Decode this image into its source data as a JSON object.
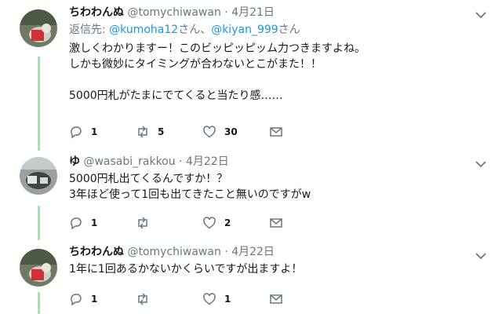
{
  "tweets": [
    {
      "name": "ちわわんぬ",
      "handle": "@tomychiwawan",
      "sep": "·",
      "date": "4月21日",
      "reply": {
        "prefix": "返信先: ",
        "user1": "@kumoha12",
        "joiner": "さん、",
        "user2": "@kiyan_999",
        "suffix": "さん"
      },
      "lines": [
        "激しくわかりますー！このビッピッピッム力つきますよね。",
        "しかも微妙にタイミングが合わないとこがまた！！",
        "",
        "5000円札がたまにでてくると当たり感……"
      ],
      "counts": {
        "reply": "1",
        "retweet": "5",
        "like": "30"
      }
    },
    {
      "name": "ゆ",
      "handle": "@wasabi_rakkou",
      "sep": "·",
      "date": "4月22日",
      "lines": [
        "5000円札出てくるんですか！？",
        "3年ほど使って1回も出てきたこと無いのですがw"
      ],
      "counts": {
        "reply": "1",
        "retweet": "",
        "like": "2"
      }
    },
    {
      "name": "ちわわんぬ",
      "handle": "@tomychiwawan",
      "sep": "·",
      "date": "4月22日",
      "lines": [
        "1年に1回あるかないかくらいですが出ますよ！"
      ],
      "counts": {
        "reply": "1",
        "retweet": "",
        "like": "1"
      }
    }
  ],
  "icons": [
    "reply-icon",
    "retweet-icon",
    "like-icon",
    "dm-icon",
    "chevron-down-icon"
  ],
  "colors": {
    "thread_line": "#a8e0b4",
    "link": "#1b95e0",
    "muted": "#657786"
  }
}
